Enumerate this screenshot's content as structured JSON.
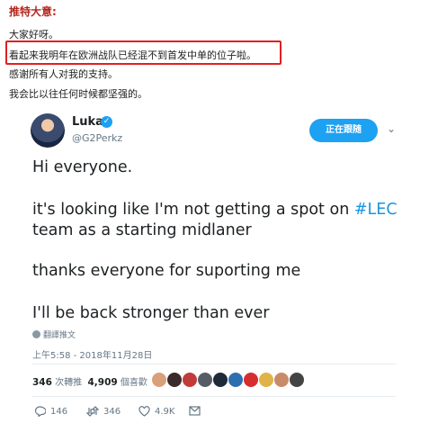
{
  "translation": {
    "title": "推特大意:",
    "lines": [
      "大家好呀。",
      "看起来我明年在欧洲战队已经混不到首发中单的位子啦。",
      "感谢所有人对我的支持。",
      "我会比以往任何时候都坚强的。"
    ]
  },
  "tweet": {
    "author_name": "Luka",
    "handle": "@G2Perkz",
    "follow_label": "正在跟随",
    "text_lines": [
      "Hi everyone.",
      "it's looking like I'm not getting a spot on ",
      "#LEC",
      "team as a starting midlaner",
      "thanks everyone for suporting me",
      "I'll be back stronger than ever"
    ],
    "translate_label": "翻譯推文",
    "timestamp": "上午5:58 - 2018年11月28日",
    "retweet_count": "346",
    "retweet_label": "次轉推",
    "like_count": "4,909",
    "like_label": "個喜歡",
    "reply_count": "146",
    "retweet_action_count": "346",
    "like_action_count": "4.9K"
  },
  "colors": {
    "accent": "#1da1f2",
    "highlight_box": "#e02020",
    "title_red": "#b4261e"
  },
  "likers": [
    {
      "color": "#d9a07a"
    },
    {
      "color": "#3b2a2a"
    },
    {
      "color": "#c23b3b"
    },
    {
      "color": "#555c66"
    },
    {
      "color": "#1e2a3a"
    },
    {
      "color": "#2b6fb0"
    },
    {
      "color": "#d62d2d"
    },
    {
      "color": "#e0b24a"
    },
    {
      "color": "#c98a6a"
    },
    {
      "color": "#444444"
    }
  ]
}
